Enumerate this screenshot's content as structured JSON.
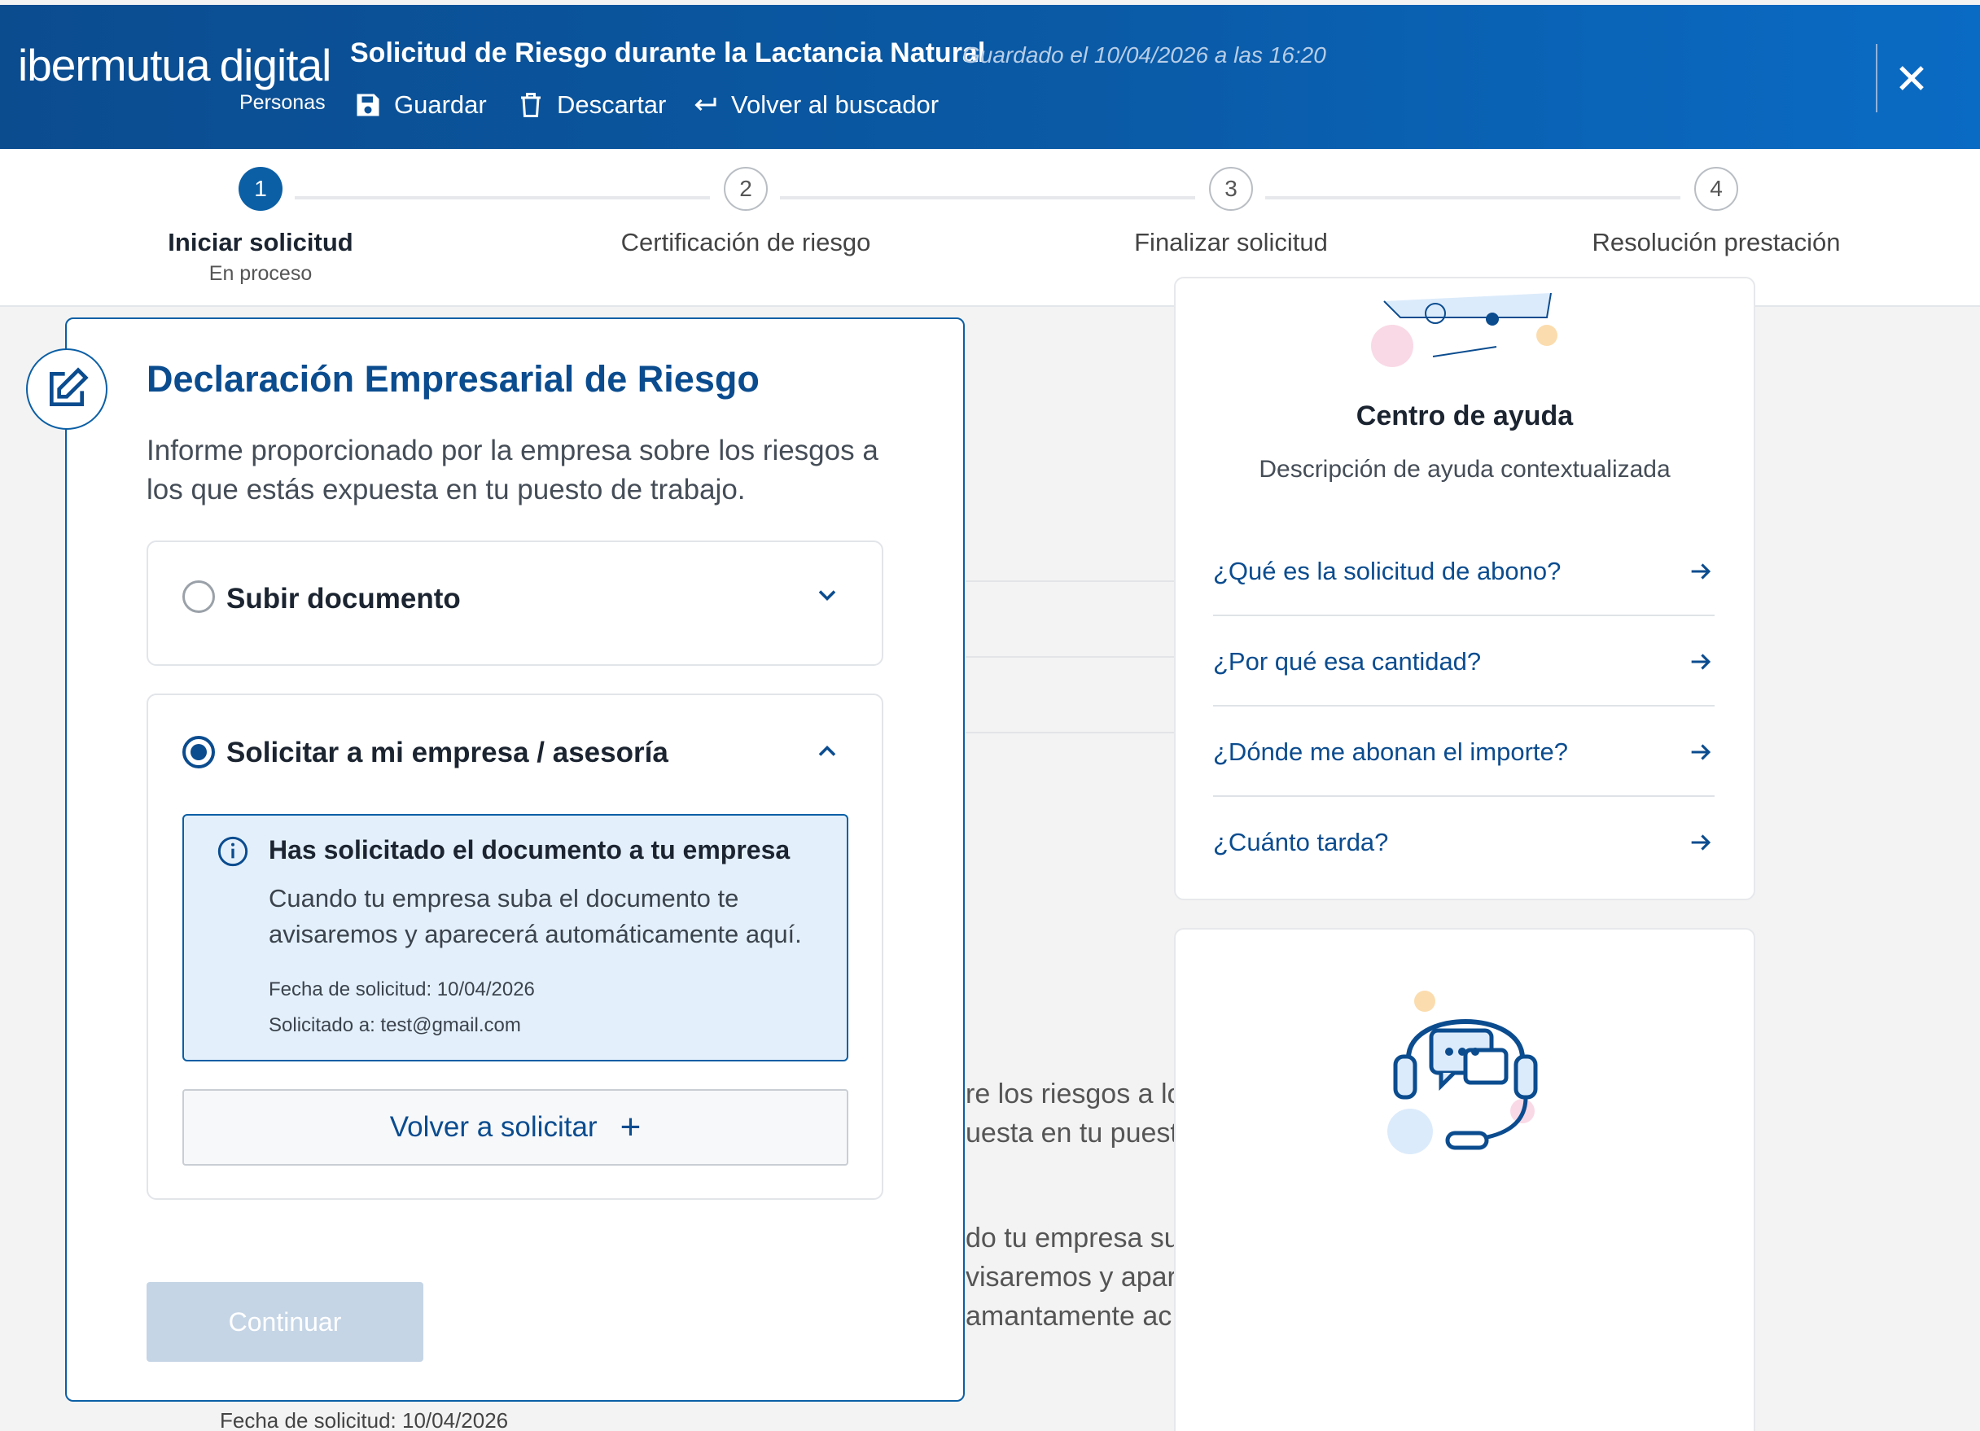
{
  "header": {
    "logo_text_1": "ibermutua",
    "logo_text_2": "digital",
    "logo_sub": "Personas",
    "title": "Solicitud de Riesgo durante la Lactancia Natural",
    "saved_status": "Guardado el 10/04/2026 a las 16:20",
    "actions": {
      "save": "Guardar",
      "discard": "Descartar",
      "back": "Volver al buscador"
    }
  },
  "stepper": {
    "steps": [
      {
        "number": "1",
        "label": "Iniciar solicitud",
        "status": "En proceso"
      },
      {
        "number": "2",
        "label": "Certificación de riesgo"
      },
      {
        "number": "3",
        "label": "Finalizar solicitud"
      },
      {
        "number": "4",
        "label": "Resolución prestación"
      }
    ]
  },
  "card": {
    "title": "Declaración Empresarial de Riesgo",
    "description": "Informe proporcionado por la empresa sobre los riesgos a los que estás expuesta en tu puesto de trabajo.",
    "option_upload": "Subir documento",
    "option_request": "Solicitar a mi empresa / asesoría",
    "info": {
      "title": "Has solicitado el documento a tu empresa",
      "body": "Cuando tu empresa suba el documento te avisaremos y aparecerá automáticamente aquí.",
      "request_date": "Fecha de solicitud: 10/04/2026",
      "requested_to": "Solicitado a: test@gmail.com"
    },
    "resend_label": "Volver a solicitar",
    "continue_label": "Continuar"
  },
  "background": {
    "ghost_1": "re los riesgos a lo",
    "ghost_2": "uesta en tu puest",
    "ghost_3": "do tu empresa su",
    "ghost_4": "visaremos y apar",
    "ghost_5": "amantamente ac",
    "below_text": "Fecha de solicitud: 10/04/2026"
  },
  "help": {
    "title": "Centro de ayuda",
    "description": "Descripción de ayuda contextualizada",
    "links": [
      "¿Qué es la solicitud de abono?",
      "¿Por qué esa cantidad?",
      "¿Dónde me abonan el importe?",
      "¿Cuánto tarda?"
    ]
  },
  "colors": {
    "primary": "#0b4c8f",
    "header_start": "#0b4c8f",
    "header_end": "#0a6bc4",
    "info_bg": "#e3f0fb",
    "disabled_button": "#c5d5e6"
  }
}
